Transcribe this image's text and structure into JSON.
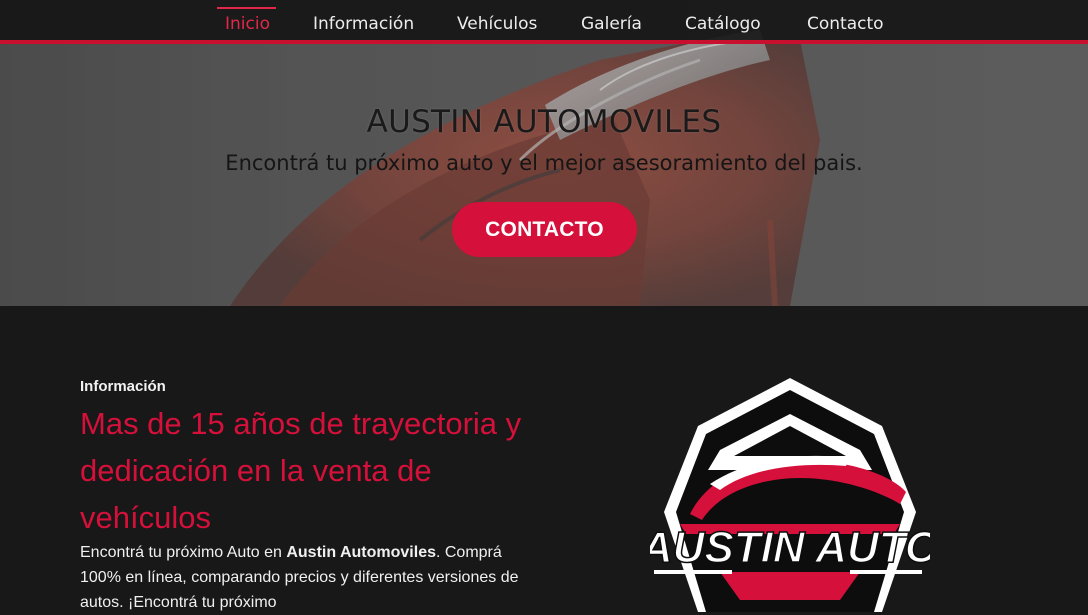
{
  "nav": {
    "items": [
      {
        "label": "Inicio",
        "active": true
      },
      {
        "label": "Información",
        "active": false
      },
      {
        "label": "Vehículos",
        "active": false
      },
      {
        "label": "Galería",
        "active": false
      },
      {
        "label": "Catálogo",
        "active": false
      },
      {
        "label": "Contacto",
        "active": false
      }
    ]
  },
  "hero": {
    "title": "AUSTIN AUTOMOVILES",
    "subtitle": "Encontrá tu próximo auto y el mejor asesoramiento del pais.",
    "cta_label": "CONTACTO"
  },
  "info": {
    "eyebrow": "Información",
    "heading": "Mas de 15 años de trayectoria y dedicación en la venta de vehículos",
    "body_part1": "Encontrá tu próximo Auto en ",
    "body_brand": "Austin Automoviles",
    "body_part2": ". Comprá 100% en línea, comparando precios y diferentes versiones de autos. ¡Encontrá tu próximo"
  },
  "logo": {
    "text": "AUSTIN AUTO"
  },
  "colors": {
    "accent": "#d5103a",
    "nav_active": "#e0294a",
    "background": "#181818"
  }
}
